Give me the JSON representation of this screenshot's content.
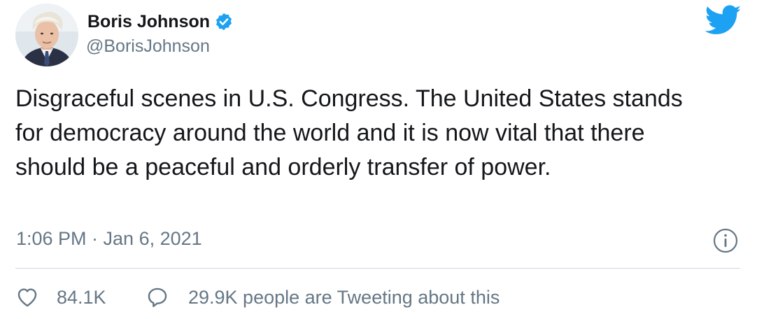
{
  "author": {
    "name": "Boris Johnson",
    "handle": "@BorisJohnson",
    "verified": true,
    "avatar_icon": "profile-photo"
  },
  "brand": {
    "logo_icon": "twitter-bird-icon",
    "color": "#1da1f2"
  },
  "tweet": {
    "text": "Disgraceful scenes in U.S. Congress. The United States stands for democracy around the world and it is now vital that there should be a peaceful and orderly transfer of power.",
    "timestamp": "1:06 PM · Jan 6, 2021"
  },
  "actions": {
    "like_icon": "heart-icon",
    "like_count": "84.1K",
    "reply_icon": "speech-bubble-icon",
    "conversation_text": "29.9K people are Tweeting about this"
  },
  "colors": {
    "text_primary": "#14171a",
    "text_secondary": "#657786",
    "divider": "#ccd6dd",
    "verified": "#1da1f2"
  }
}
